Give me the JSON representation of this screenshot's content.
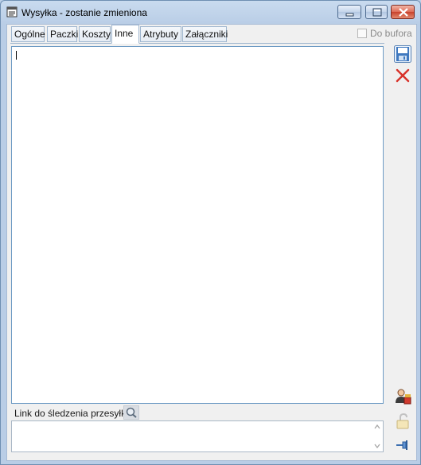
{
  "window": {
    "title": "Wysyłka - zostanie zmieniona",
    "accent_color": "#b9cde6"
  },
  "title_buttons": {
    "minimize_icon": "minimize-icon",
    "maximize_icon": "maximize-icon",
    "close_icon": "close-icon"
  },
  "tabs": [
    {
      "label": "Ogólne",
      "active": false
    },
    {
      "label": "Paczki",
      "active": false
    },
    {
      "label": "Koszty",
      "active": false
    },
    {
      "label": "Inne",
      "active": true
    },
    {
      "label": "Atrybuty",
      "active": false
    },
    {
      "label": "Załączniki",
      "active": false
    }
  ],
  "do_bufora": {
    "label": "Do bufora",
    "checked": false
  },
  "notes": {
    "value": ""
  },
  "link": {
    "label": "Link do śledzenia przesyłki:",
    "value": ""
  },
  "side_buttons": {
    "save_icon": "save-disk-icon",
    "cancel_icon": "cancel-x-icon",
    "user_icon": "user-permissions-icon",
    "lock_icon": "padlock-icon",
    "pin_icon": "pin-icon"
  }
}
